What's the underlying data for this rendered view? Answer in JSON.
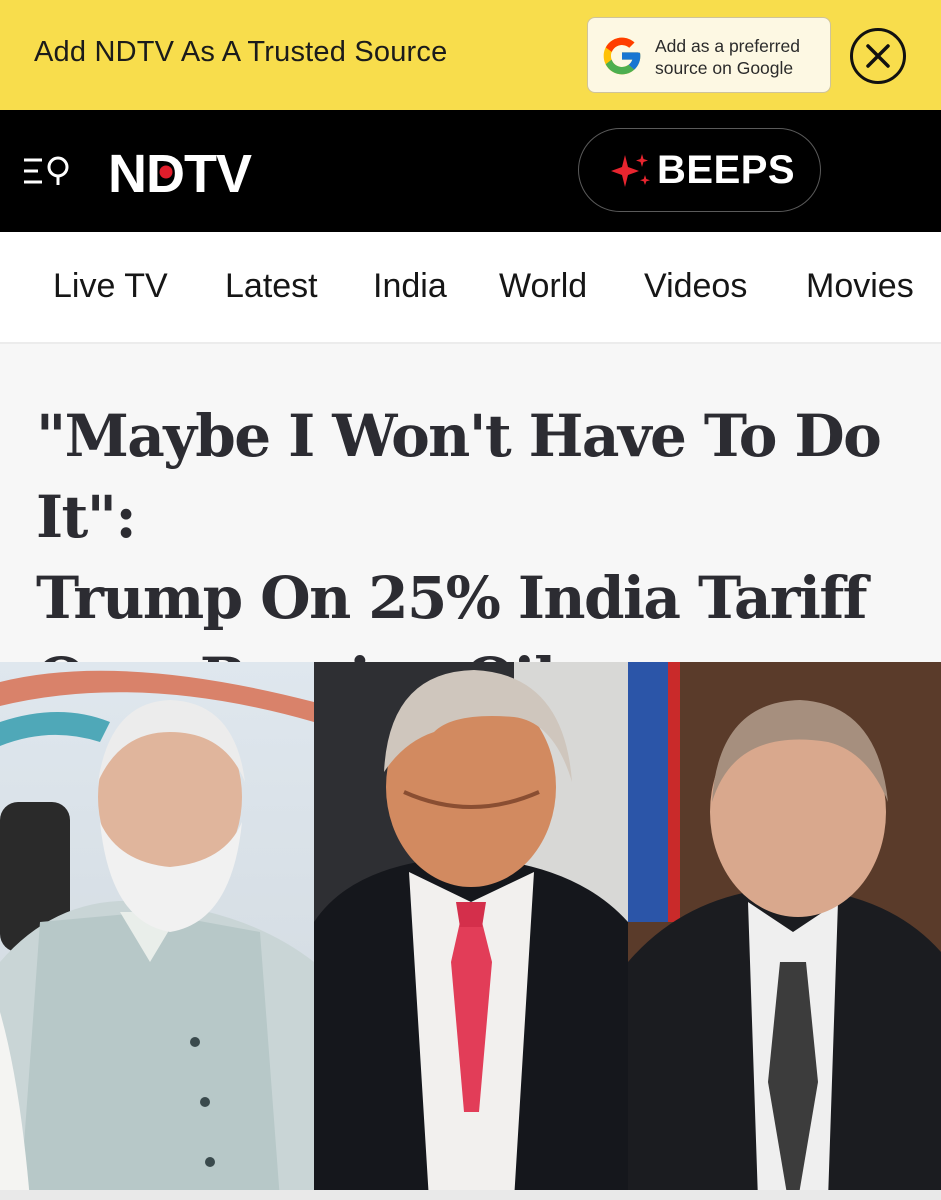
{
  "promo": {
    "text": "Add NDTV As A Trusted Source",
    "google_button_line1": "Add as a preferred",
    "google_button_line2": "source on Google",
    "close_icon": "close-icon"
  },
  "header": {
    "menu_icon": "menu-search-icon",
    "logo_text": "NDTV",
    "beeps_icon": "sparkle-icon",
    "beeps_label": "BEEPS"
  },
  "nav": {
    "items": [
      {
        "label": "Live TV",
        "live": true
      },
      {
        "label": "Latest"
      },
      {
        "label": "India"
      },
      {
        "label": "World"
      },
      {
        "label": "Videos"
      },
      {
        "label": "Movies"
      }
    ]
  },
  "article": {
    "headline_line1": "\"Maybe I Won't Have To Do It\":",
    "headline_line2": "Trump On 25% India Tariff",
    "headline_line3": "Over Russian Oil"
  },
  "colors": {
    "promo_bg": "#f8dd4c",
    "header_bg": "#000000",
    "live_dot": "#e8595c",
    "logo_dot": "#e11d2b",
    "headline": "#2c2c32"
  }
}
